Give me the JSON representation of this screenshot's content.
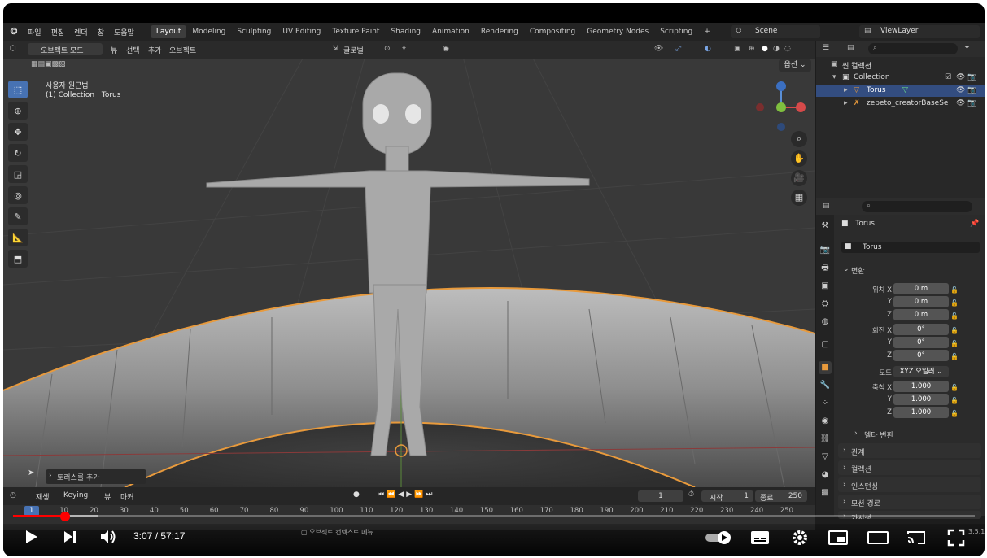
{
  "menu": {
    "items": [
      "파일",
      "편집",
      "렌더",
      "창",
      "도움말"
    ],
    "workspaces": [
      "Layout",
      "Modeling",
      "Sculpting",
      "UV Editing",
      "Texture Paint",
      "Shading",
      "Animation",
      "Rendering",
      "Compositing",
      "Geometry Nodes",
      "Scripting"
    ],
    "add_tab": "+",
    "scene": "Scene",
    "view_layer": "ViewLayer"
  },
  "viewport": {
    "mode": "오브젝트 모드",
    "menus": [
      "뷰",
      "선택",
      "추가",
      "오브젝트"
    ],
    "transform_orientation": "글로벌",
    "options": "옵션",
    "view_name": "사용자 원근법",
    "object_info": "(1) Collection | Torus",
    "last_op": "토러스를 추가"
  },
  "outliner": {
    "scene_collection": "씬 컬렉션",
    "rows": [
      "Collection",
      "Torus",
      "zepeto_creatorBaseSe"
    ]
  },
  "properties": {
    "object_name": "Torus",
    "datablock": "Torus",
    "transform_title": "변환",
    "location_label": "위치 X",
    "rotation_label": "회전 X",
    "scale_label": "축척 X",
    "axis_y": "Y",
    "axis_z": "Z",
    "location": [
      "0 m",
      "0 m",
      "0 m"
    ],
    "rotation": [
      "0°",
      "0°",
      "0°"
    ],
    "mode_label": "모드",
    "mode_value": "XYZ 오일러",
    "scale": [
      "1.000",
      "1.000",
      "1.000"
    ],
    "sections": [
      "델타 변환",
      "관계",
      "컬렉션",
      "인스턴싱",
      "모션 경로",
      "가시성"
    ]
  },
  "timeline": {
    "menus": [
      "재생",
      "Keying",
      "뷰",
      "마커"
    ],
    "current_frame": "1",
    "start_label": "시작",
    "start": "1",
    "end_label": "종료",
    "end": "250",
    "ticks": [
      "1",
      "10",
      "20",
      "30",
      "40",
      "50",
      "60",
      "70",
      "80",
      "90",
      "100",
      "110",
      "120",
      "130",
      "140",
      "150",
      "160",
      "170",
      "180",
      "190",
      "200",
      "210",
      "220",
      "230",
      "240",
      "250"
    ]
  },
  "status": {
    "context_menu": "오브젝트 컨텍스트 메뉴",
    "version": "3.5.1"
  },
  "player": {
    "current_time": "3:07",
    "separator": " / ",
    "duration": "57:17",
    "progress_fraction": 0.054,
    "colors": {
      "progress": "#ff0000",
      "selection": "#4772b3",
      "outline": "#e89a3c"
    }
  }
}
